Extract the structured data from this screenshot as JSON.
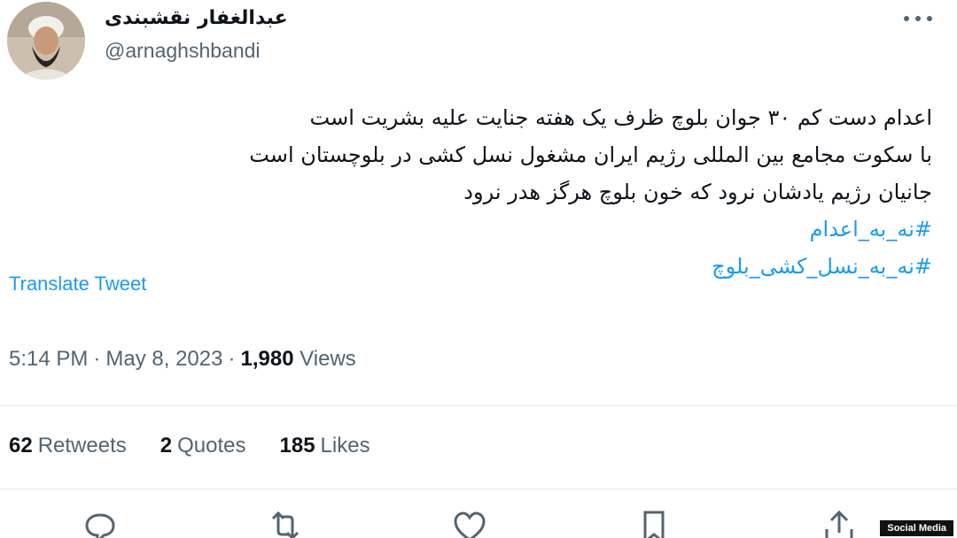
{
  "author": {
    "name": "عبدالغفار نقشبندی",
    "handle": "@arnaghshbandi"
  },
  "tweet": {
    "lines": [
      "اعدام دست کم ۳۰ جوان بلوچ ظرف یک هفته جنایت علیه بشریت است",
      "با سکوت مجامع بین المللی رژیم ایران مشغول نسل کشی در بلوچستان است",
      "جانیان رژیم یادشان نرود که خون بلوچ هرگز هدر نرود"
    ],
    "hashtags": [
      "#نه_به_اعدام",
      "#نه_به_نسل_کشی_بلوچ"
    ]
  },
  "translate_label": "Translate Tweet",
  "meta": {
    "time": "5:14 PM",
    "separator": "·",
    "date": "May 8, 2023",
    "views_count": "1,980",
    "views_label": "Views"
  },
  "stats": {
    "retweets_count": "62",
    "retweets_label": "Retweets",
    "quotes_count": "2",
    "quotes_label": "Quotes",
    "likes_count": "185",
    "likes_label": "Likes"
  },
  "icons": {
    "more": "more-horizontal-icon",
    "reply": "reply-icon",
    "retweet": "retweet-icon",
    "like": "heart-icon",
    "bookmark": "bookmark-icon",
    "share": "share-icon"
  },
  "colors": {
    "link": "#1d9bf0",
    "secondary_text": "#536471",
    "primary_text": "#0f1419"
  },
  "watermark": "Social Media"
}
